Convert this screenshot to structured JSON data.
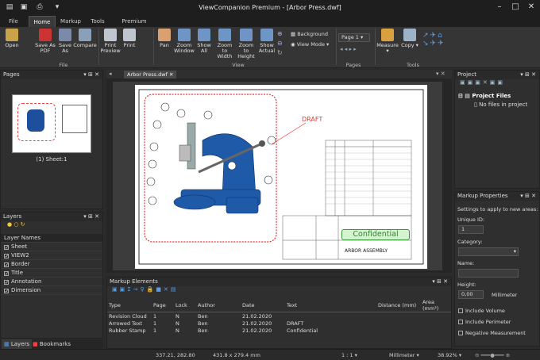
{
  "app": {
    "title": "ViewCompanion Premium - [Arbor Press.dwf]"
  },
  "tabs": [
    "File",
    "Home",
    "Markup",
    "Tools",
    "Premium Tools"
  ],
  "ribbon": {
    "buttons": [
      "Open",
      "Save As PDF",
      "Save As",
      "Compare",
      "Print Preview",
      "Print",
      "Pan",
      "Zoom Window",
      "Show All",
      "Zoom to Width",
      "Zoom to Height",
      "Show Actual",
      "Measure",
      "Copy"
    ],
    "small": [
      "Background",
      "View Mode"
    ],
    "page_select": "Page 1",
    "groups": [
      "File",
      "View",
      "Pages",
      "Tools"
    ]
  },
  "pages_panel": {
    "title": "Pages",
    "thumb_label": "(1) Sheet:1"
  },
  "layers_panel": {
    "title": "Layers",
    "header": "Layer Names",
    "items": [
      "Sheet",
      "VIEW2",
      "Border",
      "Title",
      "Annotation",
      "Dimension"
    ]
  },
  "bottom_tabs": [
    "Layers",
    "Bookmarks"
  ],
  "document": {
    "tab": "Arbor Press.dwf",
    "draft": "DRAFT",
    "confidential": "Confidential",
    "assembly": "ARBOR ASSEMBLY"
  },
  "markup_elements": {
    "title": "Markup Elements",
    "columns": [
      "Type",
      "Page",
      "Lock",
      "Author",
      "Date",
      "Text",
      "Distance (mm)",
      "Area (mm²)"
    ],
    "rows": [
      [
        "Revision Cloud",
        "1",
        "N",
        "Ben",
        "21.02.2020",
        "",
        "",
        ""
      ],
      [
        "Arrowed Text",
        "1",
        "N",
        "Ben",
        "21.02.2020",
        "DRAFT",
        "",
        ""
      ],
      [
        "Rubber Stamp",
        "1",
        "N",
        "Ben",
        "21.02.2020",
        "Confidential",
        "",
        ""
      ]
    ]
  },
  "project_panel": {
    "title": "Project",
    "root": "Project Files",
    "empty": "No files in project"
  },
  "markup_props": {
    "title": "Markup Properties",
    "hint": "Settings to apply to new areas:",
    "unique_id_label": "Unique ID:",
    "unique_id": "1",
    "category_label": "Category:",
    "name_label": "Name:",
    "height_label": "Height:",
    "height_value": "0,00",
    "height_unit": "Millimeter",
    "checks": [
      "Include Volume",
      "Include Perimeter",
      "Negative Measurement"
    ]
  },
  "status": {
    "coords": "337.21, 282.80",
    "size": "431.8 x 279.4 mm",
    "scale": "1 : 1",
    "unit": "Millimeter",
    "zoom": "38.92%"
  }
}
